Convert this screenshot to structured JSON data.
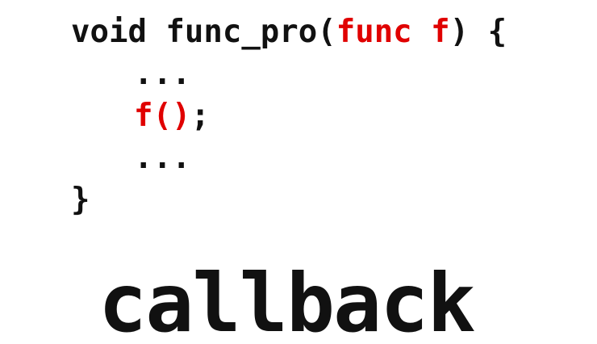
{
  "slide": {
    "code": {
      "line1": {
        "keyword": "void func_pro(",
        "param": "func f",
        "close": ") {"
      },
      "line2": "...",
      "line3": {
        "call": "f()",
        "semicolon": ";"
      },
      "line4": "...",
      "line5": "}"
    },
    "title": "callback",
    "subtitle_partial": "",
    "colors": {
      "text": "#111111",
      "highlight": "#e00000",
      "background": "#ffffff"
    }
  }
}
